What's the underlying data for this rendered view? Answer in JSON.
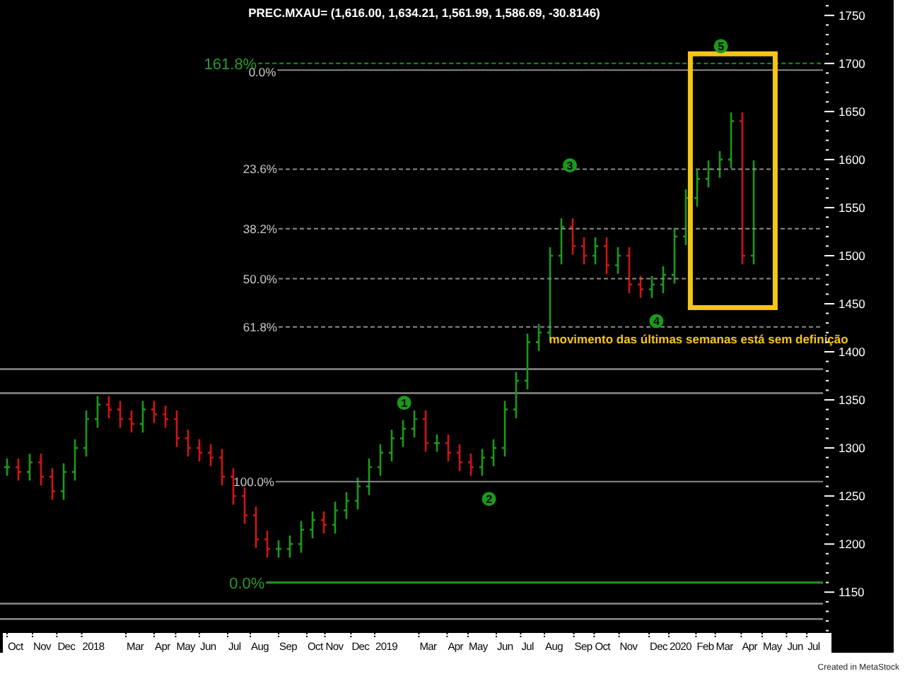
{
  "chart_title": "PREC.MXAU= (1,616.00, 1,634.21, 1,561.99, 1,586.69, -30.8146)",
  "price_axis": [
    "1750",
    "1700",
    "1650",
    "1600",
    "1550",
    "1500",
    "1450",
    "1400",
    "1350",
    "1300",
    "1250",
    "1200",
    "1150"
  ],
  "date_axis": [
    "Oct",
    "Nov",
    "Dec",
    "2018",
    "Mar",
    "Apr",
    "May",
    "Jun",
    "Jul",
    "Aug",
    "Sep",
    "Oct",
    "Nov",
    "Dec",
    "2019",
    "Mar",
    "Apr",
    "May",
    "Jun",
    "Jul",
    "Aug",
    "Sep",
    "Oct",
    "Nov",
    "Dec",
    "2020",
    "Feb",
    "Mar",
    "Apr",
    "May",
    "Jun",
    "Jul"
  ],
  "fib_levels": [
    {
      "label": "161.8%",
      "color": "#2a9a2a",
      "dashed": true
    },
    {
      "label": "0.0%",
      "color": "#c8c8c8",
      "dashed": false
    },
    {
      "label": "23.6%",
      "color": "#c8c8c8",
      "dashed": true
    },
    {
      "label": "38.2%",
      "color": "#c8c8c8",
      "dashed": true
    },
    {
      "label": "50.0%",
      "color": "#c8c8c8",
      "dashed": true
    },
    {
      "label": "61.8%",
      "color": "#c8c8c8",
      "dashed": true
    },
    {
      "label": "100.0%",
      "color": "#c8c8c8",
      "dashed": false
    },
    {
      "label": "0.0%",
      "color": "#2a9a2a",
      "dashed": false
    }
  ],
  "wave_markers": [
    "1",
    "2",
    "3",
    "4",
    "5"
  ],
  "note": "movimento das últimas semanas está sem definição",
  "footer": "Created in MetaStock"
}
